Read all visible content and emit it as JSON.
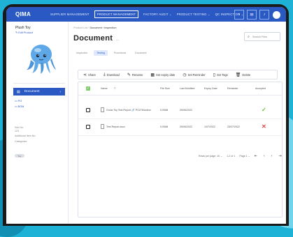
{
  "nav": {
    "logo": "QIMA",
    "items": [
      {
        "label": "SUPPLIER MANAGEMENT"
      },
      {
        "label": "PRODUCT MANAGEMENT"
      },
      {
        "label": "FACTORY AUDIT ⌄"
      },
      {
        "label": "PRODUCT TESTING ⌄"
      },
      {
        "label": "QC INSPECTION ⌄"
      }
    ],
    "active_index": 1,
    "accent_color": "#2a59c4"
  },
  "sidebar": {
    "product_name": "Plush Toy",
    "edit_label": "✎ Edit Product",
    "document_label": "Document",
    "links": [
      "PO",
      "BOM"
    ],
    "info_lines": [
      "Sub No.",
      "123",
      "Additional Item No.",
      "Categories"
    ],
    "tag": "Toy"
  },
  "main": {
    "breadcrumb_prefix": "Product List › ",
    "breadcrumb_current": "Document › Inspection",
    "title": "Document",
    "title_more": "...",
    "search_placeholder": "Search Files",
    "tabs": [
      "Inspection",
      "Testing",
      "Procedural",
      "Document"
    ],
    "active_tab": 1,
    "toolbar": [
      "Share",
      "Download",
      "Rename",
      "Set expiry date",
      "Set Reminder",
      "Set Tags",
      "Delete"
    ]
  },
  "table": {
    "headers": [
      "Name",
      "File Size",
      "Last Modified",
      "Expiry Date",
      "Reminder",
      "Accepted"
    ],
    "rows": [
      {
        "name": "Gnow Toy Test Report 🔗 PO2784cdxxx",
        "size": "5.09kB",
        "modified": "09/06/2022",
        "expiry": "",
        "reminder": "",
        "accepted": "✓"
      },
      {
        "name": "Test Report.docx",
        "size": "5.09kB",
        "modified": "09/06/2022",
        "expiry": "1/07/2022",
        "reminder": "25/07/2022",
        "accepted": "✕"
      }
    ],
    "pagination": {
      "rows_per_page": "Rows per page: 10 ⌄",
      "range": "1-2 of 1",
      "page": "Page 1 ⌄"
    }
  }
}
